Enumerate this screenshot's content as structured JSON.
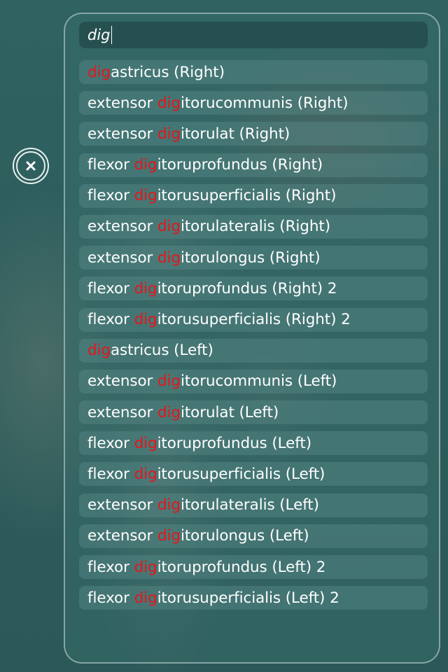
{
  "search": {
    "query": "dig"
  },
  "close_button": {
    "icon": "close-icon"
  },
  "colors": {
    "highlight": "#e8141b",
    "text": "#ffffff",
    "background": "#2f5f5e"
  },
  "results": [
    {
      "before": "",
      "match": "dig",
      "after": "astricus (Right)"
    },
    {
      "before": "extensor ",
      "match": "dig",
      "after": "itorucommunis (Right)"
    },
    {
      "before": "extensor ",
      "match": "dig",
      "after": "itorulat (Right)"
    },
    {
      "before": "flexor ",
      "match": "dig",
      "after": "itoruprofundus (Right)"
    },
    {
      "before": "flexor ",
      "match": "dig",
      "after": "itorusuperficialis (Right)"
    },
    {
      "before": "extensor ",
      "match": "dig",
      "after": "itorulateralis (Right)"
    },
    {
      "before": "extensor ",
      "match": "dig",
      "after": "itorulongus (Right)"
    },
    {
      "before": "flexor ",
      "match": "dig",
      "after": "itoruprofundus (Right) 2"
    },
    {
      "before": "flexor ",
      "match": "dig",
      "after": "itorusuperficialis (Right) 2"
    },
    {
      "before": "",
      "match": "dig",
      "after": "astricus (Left)"
    },
    {
      "before": "extensor ",
      "match": "dig",
      "after": "itorucommunis (Left)"
    },
    {
      "before": "extensor ",
      "match": "dig",
      "after": "itorulat (Left)"
    },
    {
      "before": "flexor ",
      "match": "dig",
      "after": "itoruprofundus (Left)"
    },
    {
      "before": "flexor ",
      "match": "dig",
      "after": "itorusuperficialis (Left)"
    },
    {
      "before": "extensor ",
      "match": "dig",
      "after": "itorulateralis (Left)"
    },
    {
      "before": "extensor ",
      "match": "dig",
      "after": "itorulongus (Left)"
    },
    {
      "before": "flexor ",
      "match": "dig",
      "after": "itoruprofundus (Left) 2"
    },
    {
      "before": "flexor ",
      "match": "dig",
      "after": "itorusuperficialis (Left) 2"
    }
  ]
}
